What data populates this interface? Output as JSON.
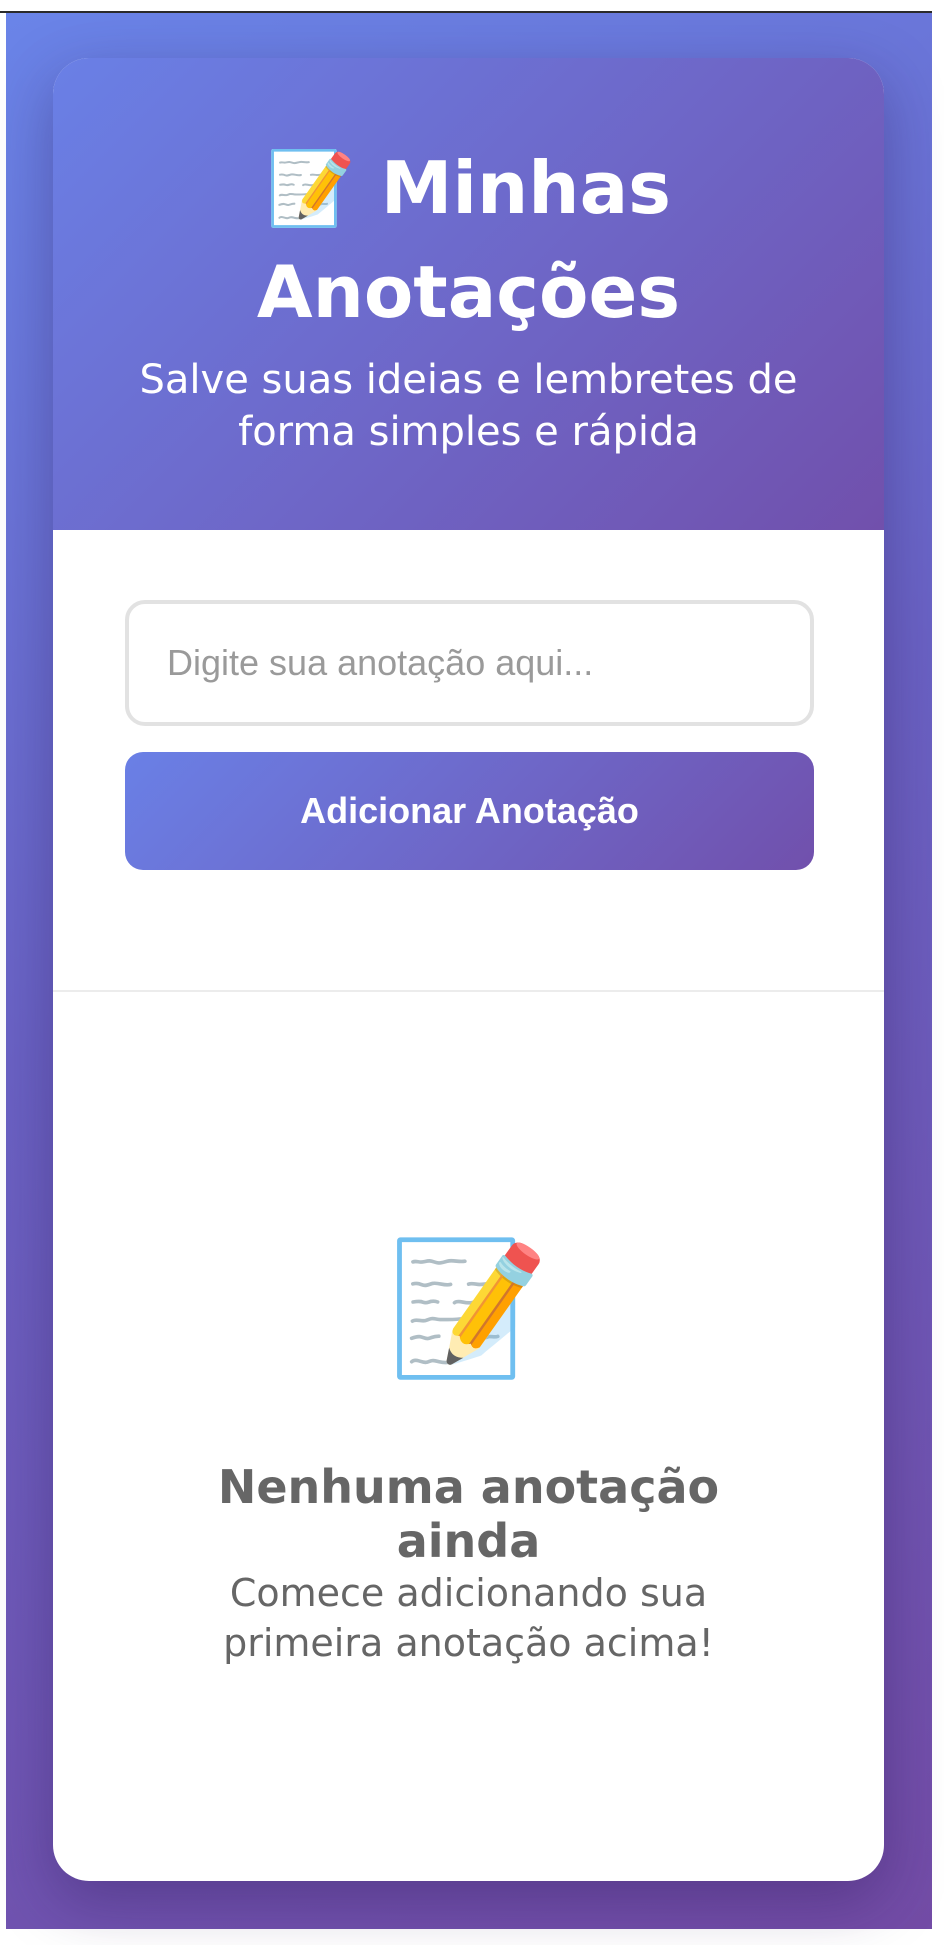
{
  "header": {
    "icon": "📝",
    "icon_name": "memo-pencil-icon",
    "title": "Minhas Anotações",
    "subtitle": "Salve suas ideias e lembretes de forma simples e rápida"
  },
  "form": {
    "input_placeholder": "Digite sua anotação aqui...",
    "input_value": "",
    "add_button_label": "Adicionar Anotação"
  },
  "empty_state": {
    "icon": "📝",
    "icon_name": "memo-pencil-icon",
    "title": "Nenhuma anotação ainda",
    "text": "Comece adicionando sua primeira anotação acima!"
  },
  "colors": {
    "gradient_start": "#667eea",
    "gradient_end": "#764ba2",
    "input_border": "#e0e0e0",
    "empty_text": "#666666"
  }
}
